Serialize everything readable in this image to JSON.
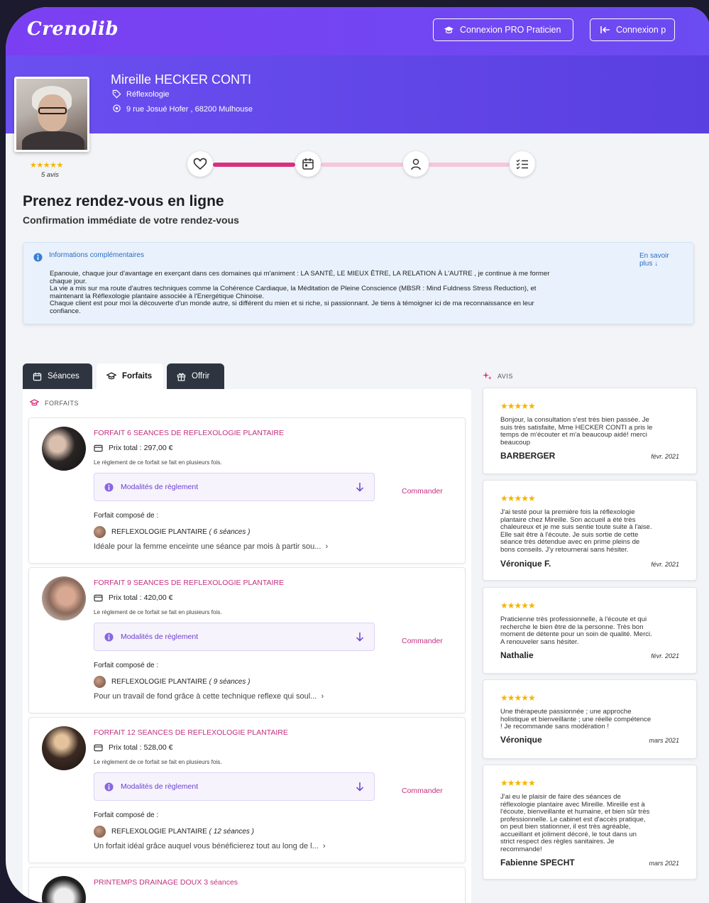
{
  "brand": {
    "logo": "Crenolib",
    "accent": "#7b3ff2",
    "pink": "#c2307e"
  },
  "header": {
    "pro_button": "Connexion PRO Praticien",
    "login_button": "Connexion p"
  },
  "practitioner": {
    "name": "Mireille HECKER CONTI",
    "specialty": "Réflexologie",
    "address": "9 rue Josué Hofer , 68200 Mulhouse",
    "rating_stars": "★★★★★",
    "reviews_count": "5 avis"
  },
  "stepper": {
    "icons": [
      "heart-icon",
      "calendar-icon",
      "user-icon",
      "checklist-icon"
    ],
    "active_step": 2
  },
  "page": {
    "title": "Prenez rendez-vous en ligne",
    "subtitle": "Confirmation immédiate de votre rendez-vous"
  },
  "info": {
    "title": "Informations complémentaires",
    "more": "En savoir plus ↓",
    "lines": [
      "Epanouie, chaque jour d'avantage en exerçant dans ces domaines qui m'animent :  LA SANTÉ, LE MIEUX ÊTRE, LA RELATION À L'AUTRE , je continue à me former",
      "chaque jour.",
      "La vie a mis sur ma route d'autres techniques comme la Cohérence Cardiaque, la Méditation de Pleine Conscience (MBSR : Mind Fuldness Stress Reduction), et",
      "maintenant la Réflexologie plantaire associée à l'Energétique Chinoise.",
      "Chaque client est pour moi la découverte d'un monde autre, si différent du mien et si riche, si passionnant. Je tiens à témoigner ici de ma reconnaissance en leur",
      "confiance."
    ]
  },
  "tabs": [
    {
      "label": "Séances"
    },
    {
      "label": "Forfaits"
    },
    {
      "label": "Offrir"
    }
  ],
  "forfaits": {
    "section_label": "FORFAITS",
    "pay_note": "Le règlement de ce forfait se fait en plusieurs fois.",
    "modalites_label": "Modalités de règlement",
    "commander_label": "Commander",
    "composed_label": "Forfait composé de :",
    "items": [
      {
        "title": "FORFAIT 6 SEANCES DE REFLEXOLOGIE PLANTAIRE",
        "price": "Prix total : 297,00 €",
        "component": "REFLEXOLOGIE PLANTAIRE",
        "count": "( 6 séances )",
        "desc": "Idéale pour la femme enceinte une séance par mois à partir sou..."
      },
      {
        "title": "FORFAIT 9 SEANCES DE REFLEXOLOGIE PLANTAIRE",
        "price": "Prix total : 420,00 €",
        "component": "REFLEXOLOGIE PLANTAIRE",
        "count": "( 9 séances )",
        "desc": "Pour un travail de fond grâce à cette technique reflexe qui soul..."
      },
      {
        "title": "FORFAIT 12 SEANCES DE REFLEXOLOGIE PLANTAIRE",
        "price": "Prix total : 528,00 €",
        "component": "REFLEXOLOGIE PLANTAIRE",
        "count": "( 12 séances )",
        "desc": "Un forfait idéal grâce auquel vous bénéficierez tout au long de l..."
      },
      {
        "title": "PRINTEMPS DRAINAGE DOUX 3 séances"
      }
    ]
  },
  "reviews": {
    "section_label": "AVIS",
    "items": [
      {
        "stars": "★★★★★",
        "lines": [
          "Bonjour, la consultation s'est très bien passée. Je",
          "suis très satisfaite, Mme HECKER CONTI a pris le",
          "temps de m'écouter et m'a beaucoup aidé! merci",
          "beaucoup"
        ],
        "author": "BARBERGER",
        "date": "févr. 2021"
      },
      {
        "stars": "★★★★★",
        "lines": [
          "J'ai testé pour la première fois la réflexologie",
          "plantaire chez Mireille. Son accueil a été très",
          "chaleureux et je me suis sentie toute suite à l'aise.",
          "Elle sait être à l'écoute. Je suis sortie de cette",
          "séance très détendue avec en prime pleins de",
          "bons conseils. J'y retournerai sans hésiter."
        ],
        "author": "Véronique F.",
        "date": "févr. 2021"
      },
      {
        "stars": "★★★★★",
        "lines": [
          "Praticienne très professionnelle, à l'écoute et qui",
          "recherche le bien être de la personne. Très bon",
          "moment de détente pour un soin de qualité. Merci.",
          "A renouveler sans hésiter."
        ],
        "author": "Nathalie",
        "date": "févr. 2021"
      },
      {
        "stars": "★★★★★",
        "lines": [
          "Une thérapeute passionnée ; une approche",
          "holistique et bienveillante ; une réelle compétence",
          "! Je recommande sans modération !"
        ],
        "author": "Véronique",
        "date": "mars 2021"
      },
      {
        "stars": "★★★★★",
        "lines": [
          "J'ai eu le plaisir de faire des séances de",
          "réflexologie plantaire avec Mireille. Mireille est à",
          "l'écoute, bienveillante et humaine, et bien sûr très",
          "professionnelle. Le cabinet est d'accès pratique,",
          "on peut bien stationner, il est très agréable,",
          "accueillant et joliment décoré, le tout dans un",
          "strict respect des règles sanitaires. Je",
          "recommande!"
        ],
        "author": "Fabienne SPECHT",
        "date": "mars 2021"
      }
    ]
  }
}
